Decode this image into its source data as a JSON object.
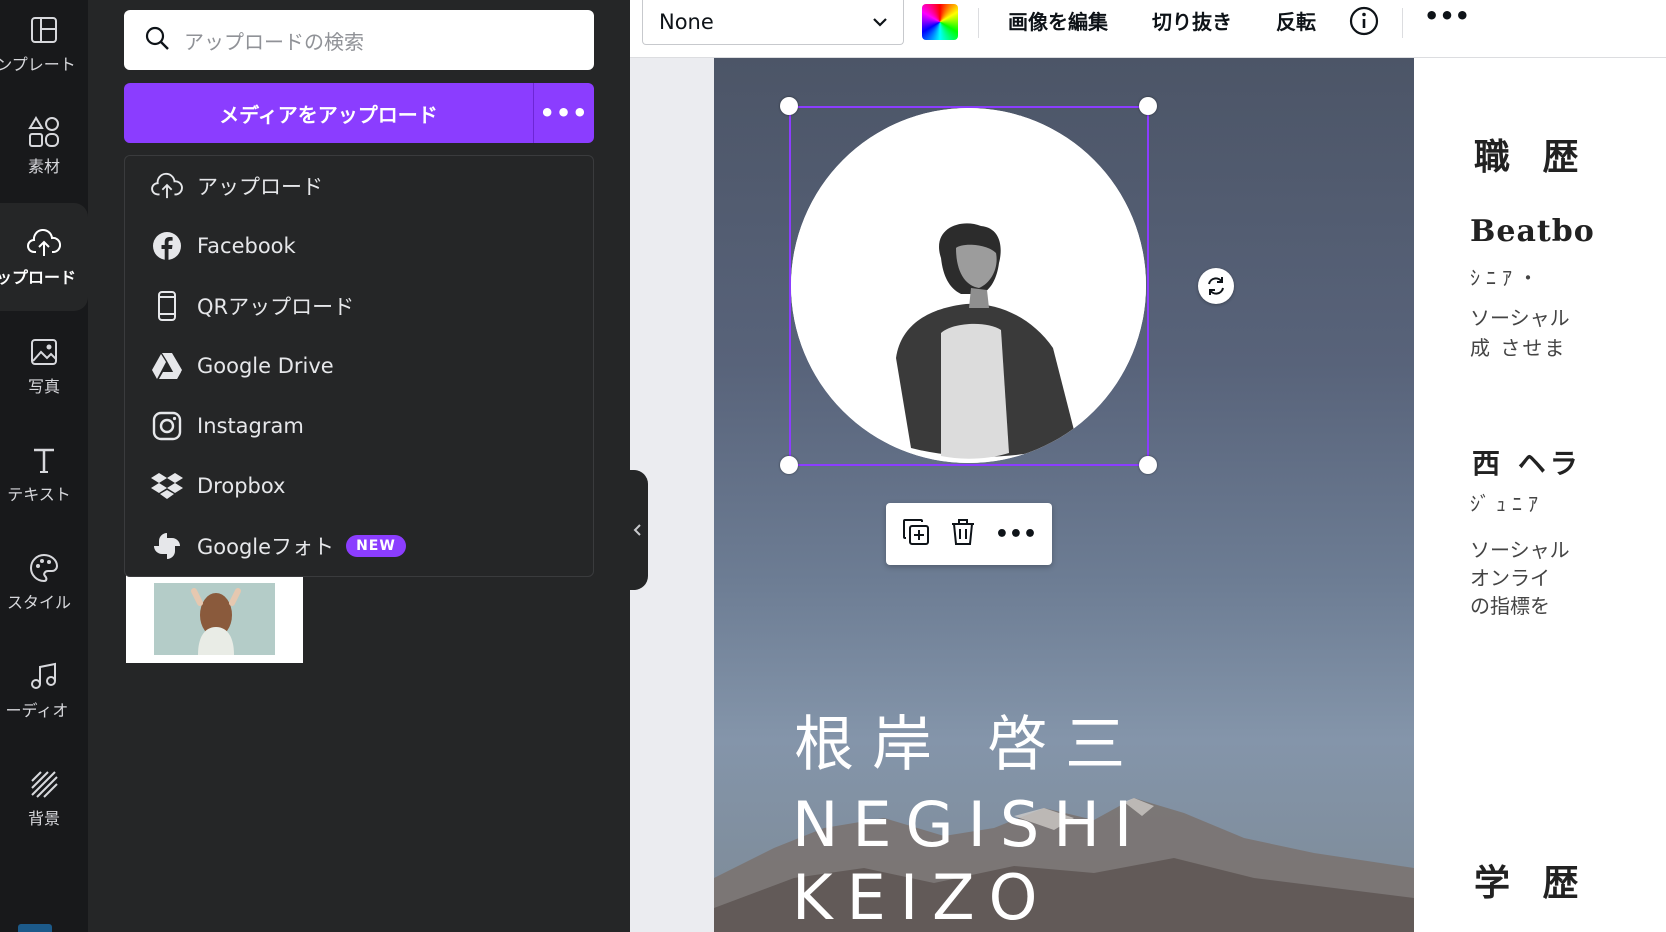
{
  "rail": {
    "items": [
      {
        "label": "ンプレート",
        "icon": "template-icon"
      },
      {
        "label": "素材",
        "icon": "elements-icon"
      },
      {
        "label": "ップロード",
        "icon": "upload-cloud-icon"
      },
      {
        "label": "写真",
        "icon": "photo-icon"
      },
      {
        "label": "テキスト",
        "icon": "text-icon"
      },
      {
        "label": "スタイル",
        "icon": "palette-icon"
      },
      {
        "label": "ーディオ",
        "icon": "music-icon"
      },
      {
        "label": "背景",
        "icon": "background-icon"
      }
    ]
  },
  "panel": {
    "search_placeholder": "アップロードの検索",
    "upload_button": "メディアをアップロード",
    "upload_more": "•••",
    "menu": [
      {
        "label": "アップロード",
        "icon": "cloud-upload-icon"
      },
      {
        "label": "Facebook",
        "icon": "facebook-icon"
      },
      {
        "label": "QRアップロード",
        "icon": "phone-icon"
      },
      {
        "label": "Google Drive",
        "icon": "google-drive-icon"
      },
      {
        "label": "Instagram",
        "icon": "instagram-icon"
      },
      {
        "label": "Dropbox",
        "icon": "dropbox-icon"
      },
      {
        "label": "Googleフォト",
        "icon": "google-photos-icon",
        "badge": "NEW"
      }
    ]
  },
  "toolbar": {
    "font_select": "None",
    "edit_image": "画像を編集",
    "crop": "切り抜き",
    "flip": "反転",
    "more": "•••"
  },
  "canvas": {
    "name_jp": "根岸 啓三",
    "name_en": "NEGISHI KEIZO",
    "ctx_more": "•••"
  },
  "right_page": {
    "heading": "職 歴",
    "company1": "Beatbo",
    "role1": "ｼﾆｱ・",
    "desc1_a": "ソーシャル",
    "desc1_b": "成 させま",
    "company2": "西 ヘラ",
    "role2": "ｼﾞｭﾆｱ",
    "desc2_a": "ソーシャル",
    "desc2_b": "オンライ",
    "desc2_c": "の指標を",
    "heading2": "学 歴"
  },
  "colors": {
    "accent": "#8b3dff",
    "rail_bg": "#18191b",
    "panel_bg": "#252627"
  }
}
